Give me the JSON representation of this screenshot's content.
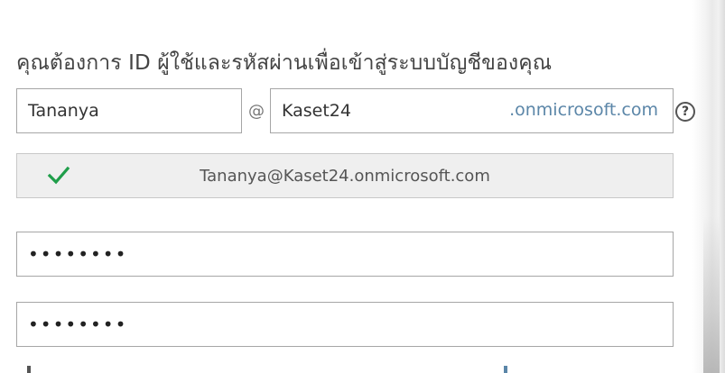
{
  "form": {
    "heading": "คุณต้องการ ID ผู้ใช้และรหัสผ่านเพื่อเข้าสู่ระบบบัญชีของคุณ",
    "username_value": "Tananya",
    "at_symbol": "@",
    "domain_value": "Kaset24",
    "domain_suffix": ".onmicrosoft.com",
    "help_glyph": "?",
    "availability_text": "Tananya@Kaset24.onmicrosoft.com",
    "availability_icon": "check-icon",
    "password_mask": "••••••••",
    "confirm_password_mask": "••••••••"
  },
  "colors": {
    "check_green": "#1f9e4a",
    "suffix_blue": "#5b86a8",
    "border_gray": "#a6a6a6",
    "result_bg": "#efefef"
  }
}
